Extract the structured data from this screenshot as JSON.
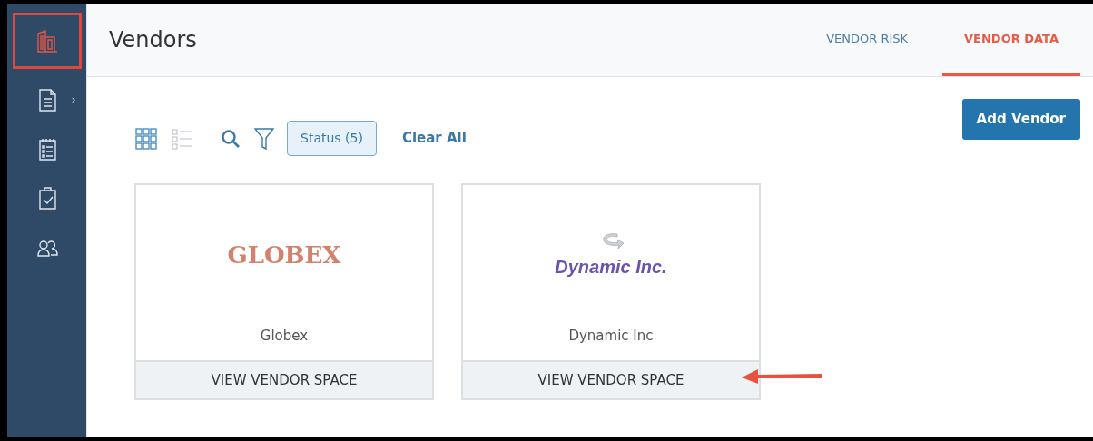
{
  "sidebar": {
    "items": [
      {
        "kind": "building",
        "selected": true,
        "highlighted": true
      },
      {
        "kind": "document",
        "selected": false,
        "highlighted": false,
        "submenu_mark": "›"
      },
      {
        "kind": "checklist",
        "selected": false,
        "highlighted": false
      },
      {
        "kind": "clipboard",
        "selected": false,
        "highlighted": false
      },
      {
        "kind": "people",
        "selected": false,
        "highlighted": false
      }
    ]
  },
  "header": {
    "title": "Vendors",
    "tabs": [
      {
        "label": "VENDOR RISK",
        "selected": false
      },
      {
        "label": "VENDOR DATA",
        "selected": true
      }
    ]
  },
  "toolbar": {
    "views": [
      {
        "kind": "grid",
        "selected": true
      },
      {
        "kind": "list",
        "selected": false
      }
    ],
    "filter_chip": "Status (5)",
    "clear_label": "Clear All",
    "add_button": "Add Vendor"
  },
  "vendors": [
    {
      "logo_text": "GLOBEX",
      "kind": "serif",
      "name": "Globex",
      "action": "VIEW VENDOR SPACE",
      "pointed": false
    },
    {
      "logo_text": "Dynamic Inc.",
      "kind": "swoosh",
      "name": "Dynamic Inc",
      "action": "VIEW VENDOR SPACE",
      "pointed": true
    }
  ]
}
